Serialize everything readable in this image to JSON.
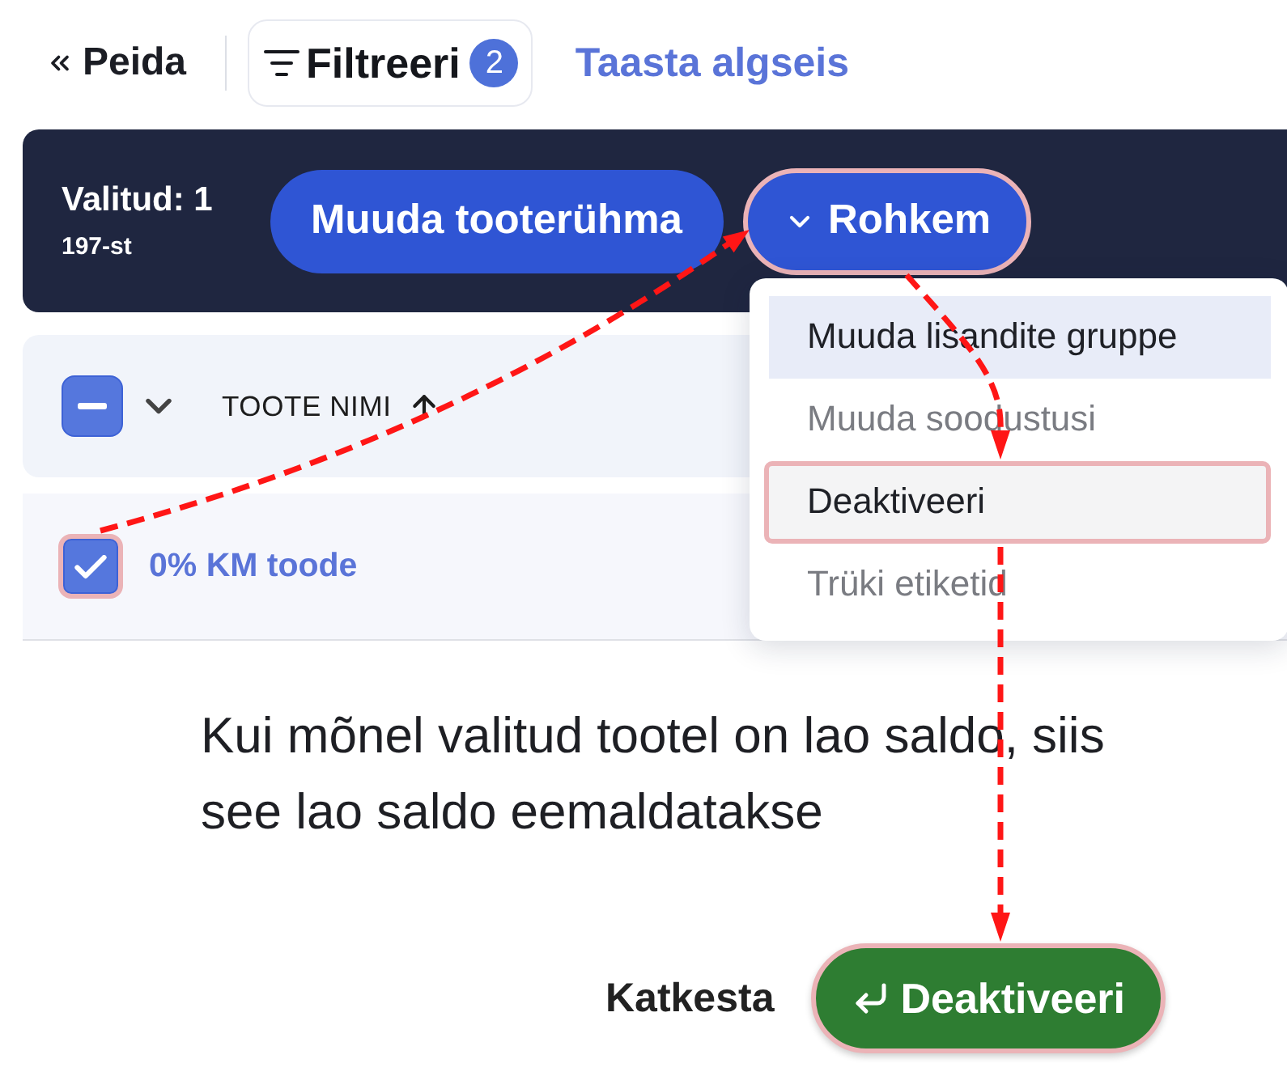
{
  "toolbar": {
    "hide_button": {
      "label": "Peida"
    },
    "filter_button": {
      "label": "Filtreeri",
      "badge": "2"
    },
    "reset_link": {
      "label": "Taasta algseis"
    }
  },
  "selection_bar": {
    "count": "Valitud: 1",
    "total": "197-st",
    "actions": [
      {
        "label": "Muuda tooterühma",
        "kind": "button",
        "highlighted": false
      },
      {
        "label": "Rohkem",
        "kind": "dropdown",
        "highlighted": true,
        "expanded": true,
        "items": [
          {
            "label": "Muuda lisandite gruppe",
            "selected": true,
            "highlighted": false
          },
          {
            "label": "Muuda soodustusi",
            "selected": false,
            "highlighted": false
          },
          {
            "label": "Deaktiveeri",
            "selected": false,
            "highlighted": true
          },
          {
            "label": "Trüki etiketid",
            "selected": false,
            "highlighted": false
          }
        ]
      }
    ]
  },
  "table": {
    "header": {
      "indeterminate": true,
      "column": "TOOTE NIMI",
      "sort_ascending": true
    },
    "rows": [
      {
        "name": "0% KM toode",
        "checked": true,
        "highlighted": true
      }
    ]
  },
  "dialog": {
    "message": "Kui mõnel valitud tootel on lao saldo, siis see lao saldo eemaldatakse",
    "cancel_button": {
      "label": "Katkesta"
    },
    "confirm_button": {
      "label": "Deaktiveeri",
      "highlighted": true
    }
  }
}
